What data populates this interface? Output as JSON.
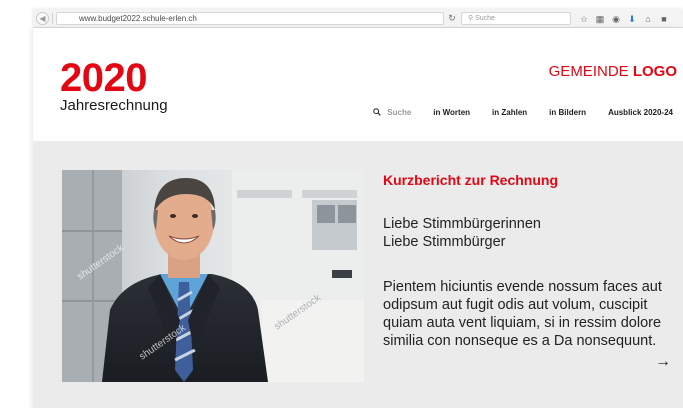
{
  "browser": {
    "url": "www.budget2022.schule-erlen.ch",
    "search_placeholder": "Suche"
  },
  "header": {
    "year": "2020",
    "subtitle": "Jahresrechnung",
    "logo_prefix": "GEMEINDE ",
    "logo_bold": "LOGO"
  },
  "nav": {
    "search_label": "Suche",
    "items": [
      "in Worten",
      "in Zahlen",
      "in Bildern",
      "Ausblick 2020-24"
    ]
  },
  "article": {
    "title": "Kurzbericht zur Rechnung",
    "greeting_1": "Liebe Stimmbürgerinnen",
    "greeting_2": "Liebe Stimmbürger",
    "body": "Pientem hiciuntis evende nossum faces aut odipsum aut fugit odis aut volum, cuscipit quiam auta vent liquiam, si in ressim dolore similia con nonseque es a Da nonsequunt.",
    "more_arrow": "→"
  },
  "photo": {
    "watermark": "shutterstock"
  },
  "colors": {
    "accent": "#e30613",
    "band": "#ebebeb"
  }
}
